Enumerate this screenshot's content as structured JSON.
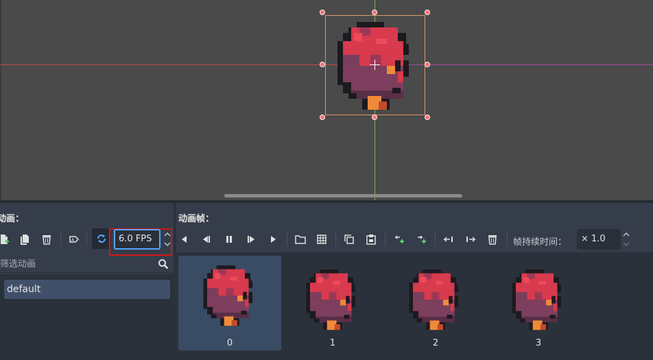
{
  "viewport": {
    "colors": {
      "background": "#4a4a4a",
      "x_axis": "#c04a4a",
      "y_axis": "#7fb04a",
      "selection": "#d89a6a",
      "handle": "#ff7070"
    }
  },
  "animations_panel": {
    "title": "动画：",
    "toolbar": [
      {
        "name": "new-animation-icon"
      },
      {
        "name": "duplicate-animation-icon"
      },
      {
        "name": "delete-animation-icon"
      },
      {
        "name": "autoplay-on-load-icon"
      },
      {
        "name": "loop-toggle-icon",
        "active": true
      }
    ],
    "fps": {
      "value": "6.0 FPS"
    },
    "filter": {
      "placeholder": "筛选动画"
    },
    "list": [
      {
        "label": "default",
        "selected": true
      }
    ]
  },
  "frames_panel": {
    "title": "动画帧：",
    "toolbar_icons": [
      "play-backwards-from-end-icon",
      "play-backwards-icon",
      "pause-icon",
      "play-icon",
      "play-from-end-icon",
      "load-file-icon",
      "load-spritesheet-icon",
      "copy-frame-icon",
      "paste-frame-icon",
      "insert-before-icon",
      "insert-after-icon",
      "move-left-icon",
      "move-right-icon",
      "delete-frame-icon"
    ],
    "duration_label": "帧持续时间：",
    "duration_value": "× 1.0",
    "frames": [
      {
        "label": "0",
        "selected": true
      },
      {
        "label": "1",
        "selected": false
      },
      {
        "label": "2",
        "selected": false
      },
      {
        "label": "3",
        "selected": false
      }
    ]
  },
  "colors": {
    "accent": "#57a7ff",
    "highlight_box": "#d01818",
    "panel_bg": "#363d4a",
    "selected_item": "#415069"
  }
}
